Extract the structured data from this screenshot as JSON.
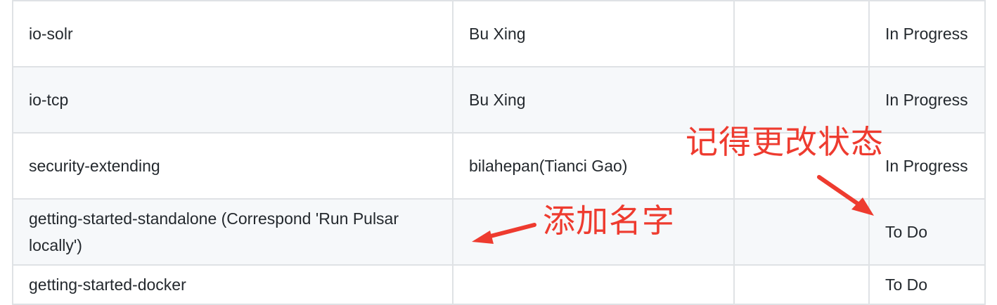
{
  "table": {
    "rows": [
      {
        "module": "io-solr",
        "assignee": "Bu Xing",
        "extra": "",
        "status": "In Progress"
      },
      {
        "module": "io-tcp",
        "assignee": "Bu Xing",
        "extra": "",
        "status": "In Progress"
      },
      {
        "module": "security-extending",
        "assignee": "bilahepan(Tianci Gao)",
        "extra": "",
        "status": "In Progress"
      },
      {
        "module": "getting-started-standalone (Correspond 'Run Pulsar locally')",
        "assignee": "",
        "extra": "",
        "status": "To Do"
      },
      {
        "module": "getting-started-docker",
        "assignee": "",
        "extra": "",
        "status": "To Do"
      }
    ]
  },
  "annotations": {
    "status_note": "记得更改状态",
    "name_note": "添加名字",
    "color": "#ee3b2f"
  },
  "colors": {
    "border": "#dfe2e5",
    "alt_row": "#f6f8fa",
    "text": "#24292e"
  }
}
